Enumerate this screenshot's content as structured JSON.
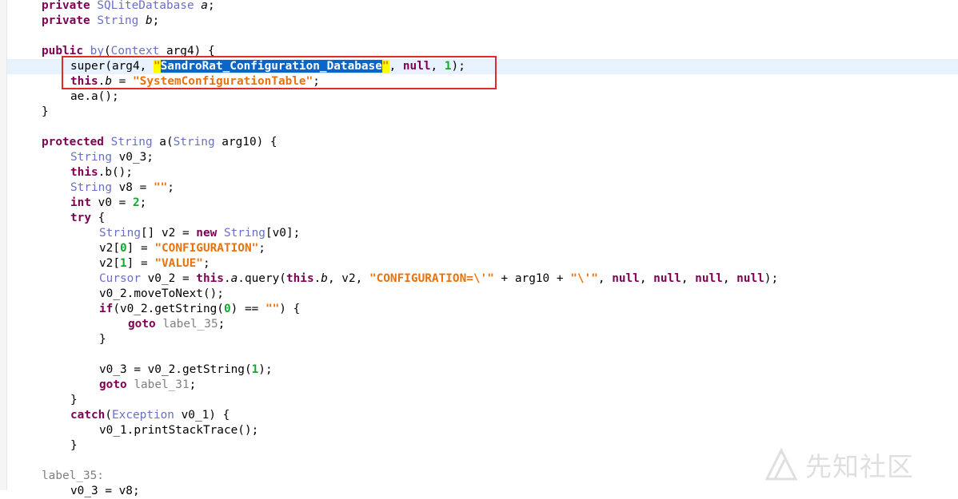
{
  "editor": {
    "lines": [
      {
        "indent": 4,
        "tokens": [
          [
            "kw",
            "private"
          ],
          [
            "p",
            " "
          ],
          [
            "ty",
            "SQLiteDatabase"
          ],
          [
            "p",
            " "
          ],
          [
            "fld",
            "a"
          ],
          [
            "p",
            ";"
          ]
        ]
      },
      {
        "indent": 4,
        "tokens": [
          [
            "kw",
            "private"
          ],
          [
            "p",
            " "
          ],
          [
            "ty",
            "String"
          ],
          [
            "p",
            " "
          ],
          [
            "fld",
            "b"
          ],
          [
            "p",
            ";"
          ]
        ]
      },
      {
        "indent": 0,
        "tokens": []
      },
      {
        "indent": 4,
        "tokens": [
          [
            "kw",
            "public"
          ],
          [
            "p",
            " "
          ],
          [
            "ty",
            "by"
          ],
          [
            "p",
            "("
          ],
          [
            "ty",
            "Context"
          ],
          [
            "p",
            " arg4) {"
          ]
        ]
      },
      {
        "indent": 8,
        "current": true,
        "tokens": [
          [
            "p",
            "super(arg4, "
          ],
          [
            "str-bracket",
            "\""
          ],
          [
            "sel",
            "SandroRat_Configuration_Database"
          ],
          [
            "str-bracket",
            "\""
          ],
          [
            "p",
            ", "
          ],
          [
            "kw",
            "null"
          ],
          [
            "p",
            ", "
          ],
          [
            "num",
            "1"
          ],
          [
            "p",
            ");"
          ]
        ]
      },
      {
        "indent": 8,
        "tokens": [
          [
            "kw",
            "this"
          ],
          [
            "p",
            "."
          ],
          [
            "fld",
            "b"
          ],
          [
            "p",
            " = "
          ],
          [
            "str",
            "\"SystemConfigurationTable\""
          ],
          [
            "p",
            ";"
          ]
        ]
      },
      {
        "indent": 8,
        "tokens": [
          [
            "p",
            "ae.a();"
          ]
        ]
      },
      {
        "indent": 4,
        "tokens": [
          [
            "p",
            "}"
          ]
        ]
      },
      {
        "indent": 0,
        "tokens": []
      },
      {
        "indent": 4,
        "tokens": [
          [
            "kw",
            "protected"
          ],
          [
            "p",
            " "
          ],
          [
            "ty",
            "String"
          ],
          [
            "p",
            " a("
          ],
          [
            "ty",
            "String"
          ],
          [
            "p",
            " arg10) {"
          ]
        ]
      },
      {
        "indent": 8,
        "tokens": [
          [
            "ty",
            "String"
          ],
          [
            "p",
            " v0_3;"
          ]
        ]
      },
      {
        "indent": 8,
        "tokens": [
          [
            "kw",
            "this"
          ],
          [
            "p",
            ".b();"
          ]
        ]
      },
      {
        "indent": 8,
        "tokens": [
          [
            "ty",
            "String"
          ],
          [
            "p",
            " v8 = "
          ],
          [
            "str",
            "\"\""
          ],
          [
            "p",
            ";"
          ]
        ]
      },
      {
        "indent": 8,
        "tokens": [
          [
            "kw",
            "int"
          ],
          [
            "p",
            " v0 = "
          ],
          [
            "num",
            "2"
          ],
          [
            "p",
            ";"
          ]
        ]
      },
      {
        "indent": 8,
        "tokens": [
          [
            "kw",
            "try"
          ],
          [
            "p",
            " {"
          ]
        ]
      },
      {
        "indent": 12,
        "tokens": [
          [
            "ty",
            "String"
          ],
          [
            "p",
            "[] v2 = "
          ],
          [
            "kw",
            "new"
          ],
          [
            "p",
            " "
          ],
          [
            "ty",
            "String"
          ],
          [
            "p",
            "[v0];"
          ]
        ]
      },
      {
        "indent": 12,
        "tokens": [
          [
            "p",
            "v2["
          ],
          [
            "num",
            "0"
          ],
          [
            "p",
            "] = "
          ],
          [
            "str",
            "\"CONFIGURATION\""
          ],
          [
            "p",
            ";"
          ]
        ]
      },
      {
        "indent": 12,
        "tokens": [
          [
            "p",
            "v2["
          ],
          [
            "num",
            "1"
          ],
          [
            "p",
            "] = "
          ],
          [
            "str",
            "\"VALUE\""
          ],
          [
            "p",
            ";"
          ]
        ]
      },
      {
        "indent": 12,
        "tokens": [
          [
            "ty",
            "Cursor"
          ],
          [
            "p",
            " v0_2 = "
          ],
          [
            "kw",
            "this"
          ],
          [
            "p",
            "."
          ],
          [
            "fld",
            "a"
          ],
          [
            "p",
            ".query("
          ],
          [
            "kw",
            "this"
          ],
          [
            "p",
            "."
          ],
          [
            "fld",
            "b"
          ],
          [
            "p",
            ", v2, "
          ],
          [
            "str",
            "\"CONFIGURATION=\\'\""
          ],
          [
            "p",
            " + arg10 + "
          ],
          [
            "str",
            "\"\\'\""
          ],
          [
            "p",
            ", "
          ],
          [
            "kw",
            "null"
          ],
          [
            "p",
            ", "
          ],
          [
            "kw",
            "null"
          ],
          [
            "p",
            ", "
          ],
          [
            "kw",
            "null"
          ],
          [
            "p",
            ", "
          ],
          [
            "kw",
            "null"
          ],
          [
            "p",
            ");"
          ]
        ]
      },
      {
        "indent": 12,
        "tokens": [
          [
            "p",
            "v0_2.moveToNext();"
          ]
        ]
      },
      {
        "indent": 12,
        "tokens": [
          [
            "kw",
            "if"
          ],
          [
            "p",
            "(v0_2.getString("
          ],
          [
            "num",
            "0"
          ],
          [
            "p",
            ") == "
          ],
          [
            "str",
            "\"\""
          ],
          [
            "p",
            ") {"
          ]
        ]
      },
      {
        "indent": 16,
        "tokens": [
          [
            "kw",
            "goto"
          ],
          [
            "p",
            " "
          ],
          [
            "lbl",
            "label_35"
          ],
          [
            "p",
            ";"
          ]
        ]
      },
      {
        "indent": 12,
        "tokens": [
          [
            "p",
            "}"
          ]
        ]
      },
      {
        "indent": 0,
        "tokens": []
      },
      {
        "indent": 12,
        "tokens": [
          [
            "p",
            "v0_3 = v0_2.getString("
          ],
          [
            "num",
            "1"
          ],
          [
            "p",
            ");"
          ]
        ]
      },
      {
        "indent": 12,
        "tokens": [
          [
            "kw",
            "goto"
          ],
          [
            "p",
            " "
          ],
          [
            "lbl",
            "label_31"
          ],
          [
            "p",
            ";"
          ]
        ]
      },
      {
        "indent": 8,
        "tokens": [
          [
            "p",
            "}"
          ]
        ]
      },
      {
        "indent": 8,
        "tokens": [
          [
            "kw",
            "catch"
          ],
          [
            "p",
            "("
          ],
          [
            "ty",
            "Exception"
          ],
          [
            "p",
            " v0_1) {"
          ]
        ]
      },
      {
        "indent": 12,
        "tokens": [
          [
            "p",
            "v0_1.printStackTrace();"
          ]
        ]
      },
      {
        "indent": 8,
        "tokens": [
          [
            "p",
            "}"
          ]
        ]
      },
      {
        "indent": 0,
        "tokens": []
      },
      {
        "indent": 4,
        "tokens": [
          [
            "lbl",
            "label_35:"
          ]
        ]
      },
      {
        "indent": 8,
        "tokens": [
          [
            "p",
            "v0_3 = v8;"
          ]
        ]
      }
    ]
  },
  "watermark": {
    "text": "先知社区",
    "icon": "xianzhi-logo-icon"
  },
  "colors": {
    "keyword": "#7f0055",
    "type": "#6a70c6",
    "string": "#e8730c",
    "number": "#17a62d",
    "label": "#808080",
    "selection": "#0b64c8",
    "current_line": "#e8f2fe",
    "highlight_box": "#e02b2b"
  }
}
